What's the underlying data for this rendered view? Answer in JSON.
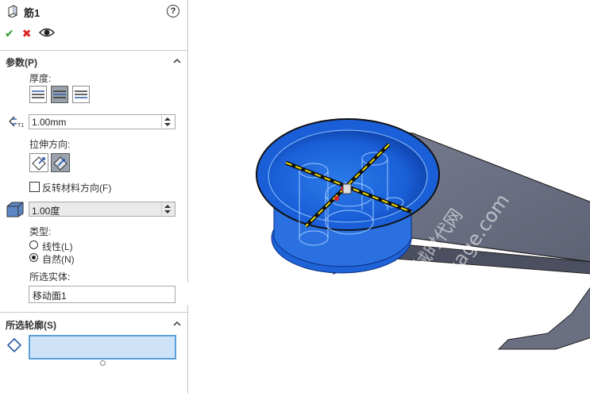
{
  "feature": {
    "title": "筋1",
    "help": "?"
  },
  "actions": {
    "ok": "✔",
    "cancel": "✖"
  },
  "params": {
    "section_title": "参数(P)",
    "thickness_label": "厚度:",
    "thickness_value": "1.00mm",
    "direction_label": "拉伸方向:",
    "flip_label": "反转材料方向(F)",
    "flip_checked": false,
    "draft_value": "1.00度",
    "type_label": "类型:",
    "type_options": [
      "线性(L)",
      "自然(N)"
    ],
    "type_selected": "自然(N)",
    "bodies_label": "所选实体:",
    "bodies_value": "移动面1"
  },
  "contours": {
    "section_title": "所选轮廓(S)"
  },
  "watermark": {
    "line1": "机械时代网",
    "line2": "www.jxage.com"
  },
  "colors": {
    "accent": "#1a5fd8",
    "part": "#6a6f82",
    "sketch": "#f0e000"
  }
}
